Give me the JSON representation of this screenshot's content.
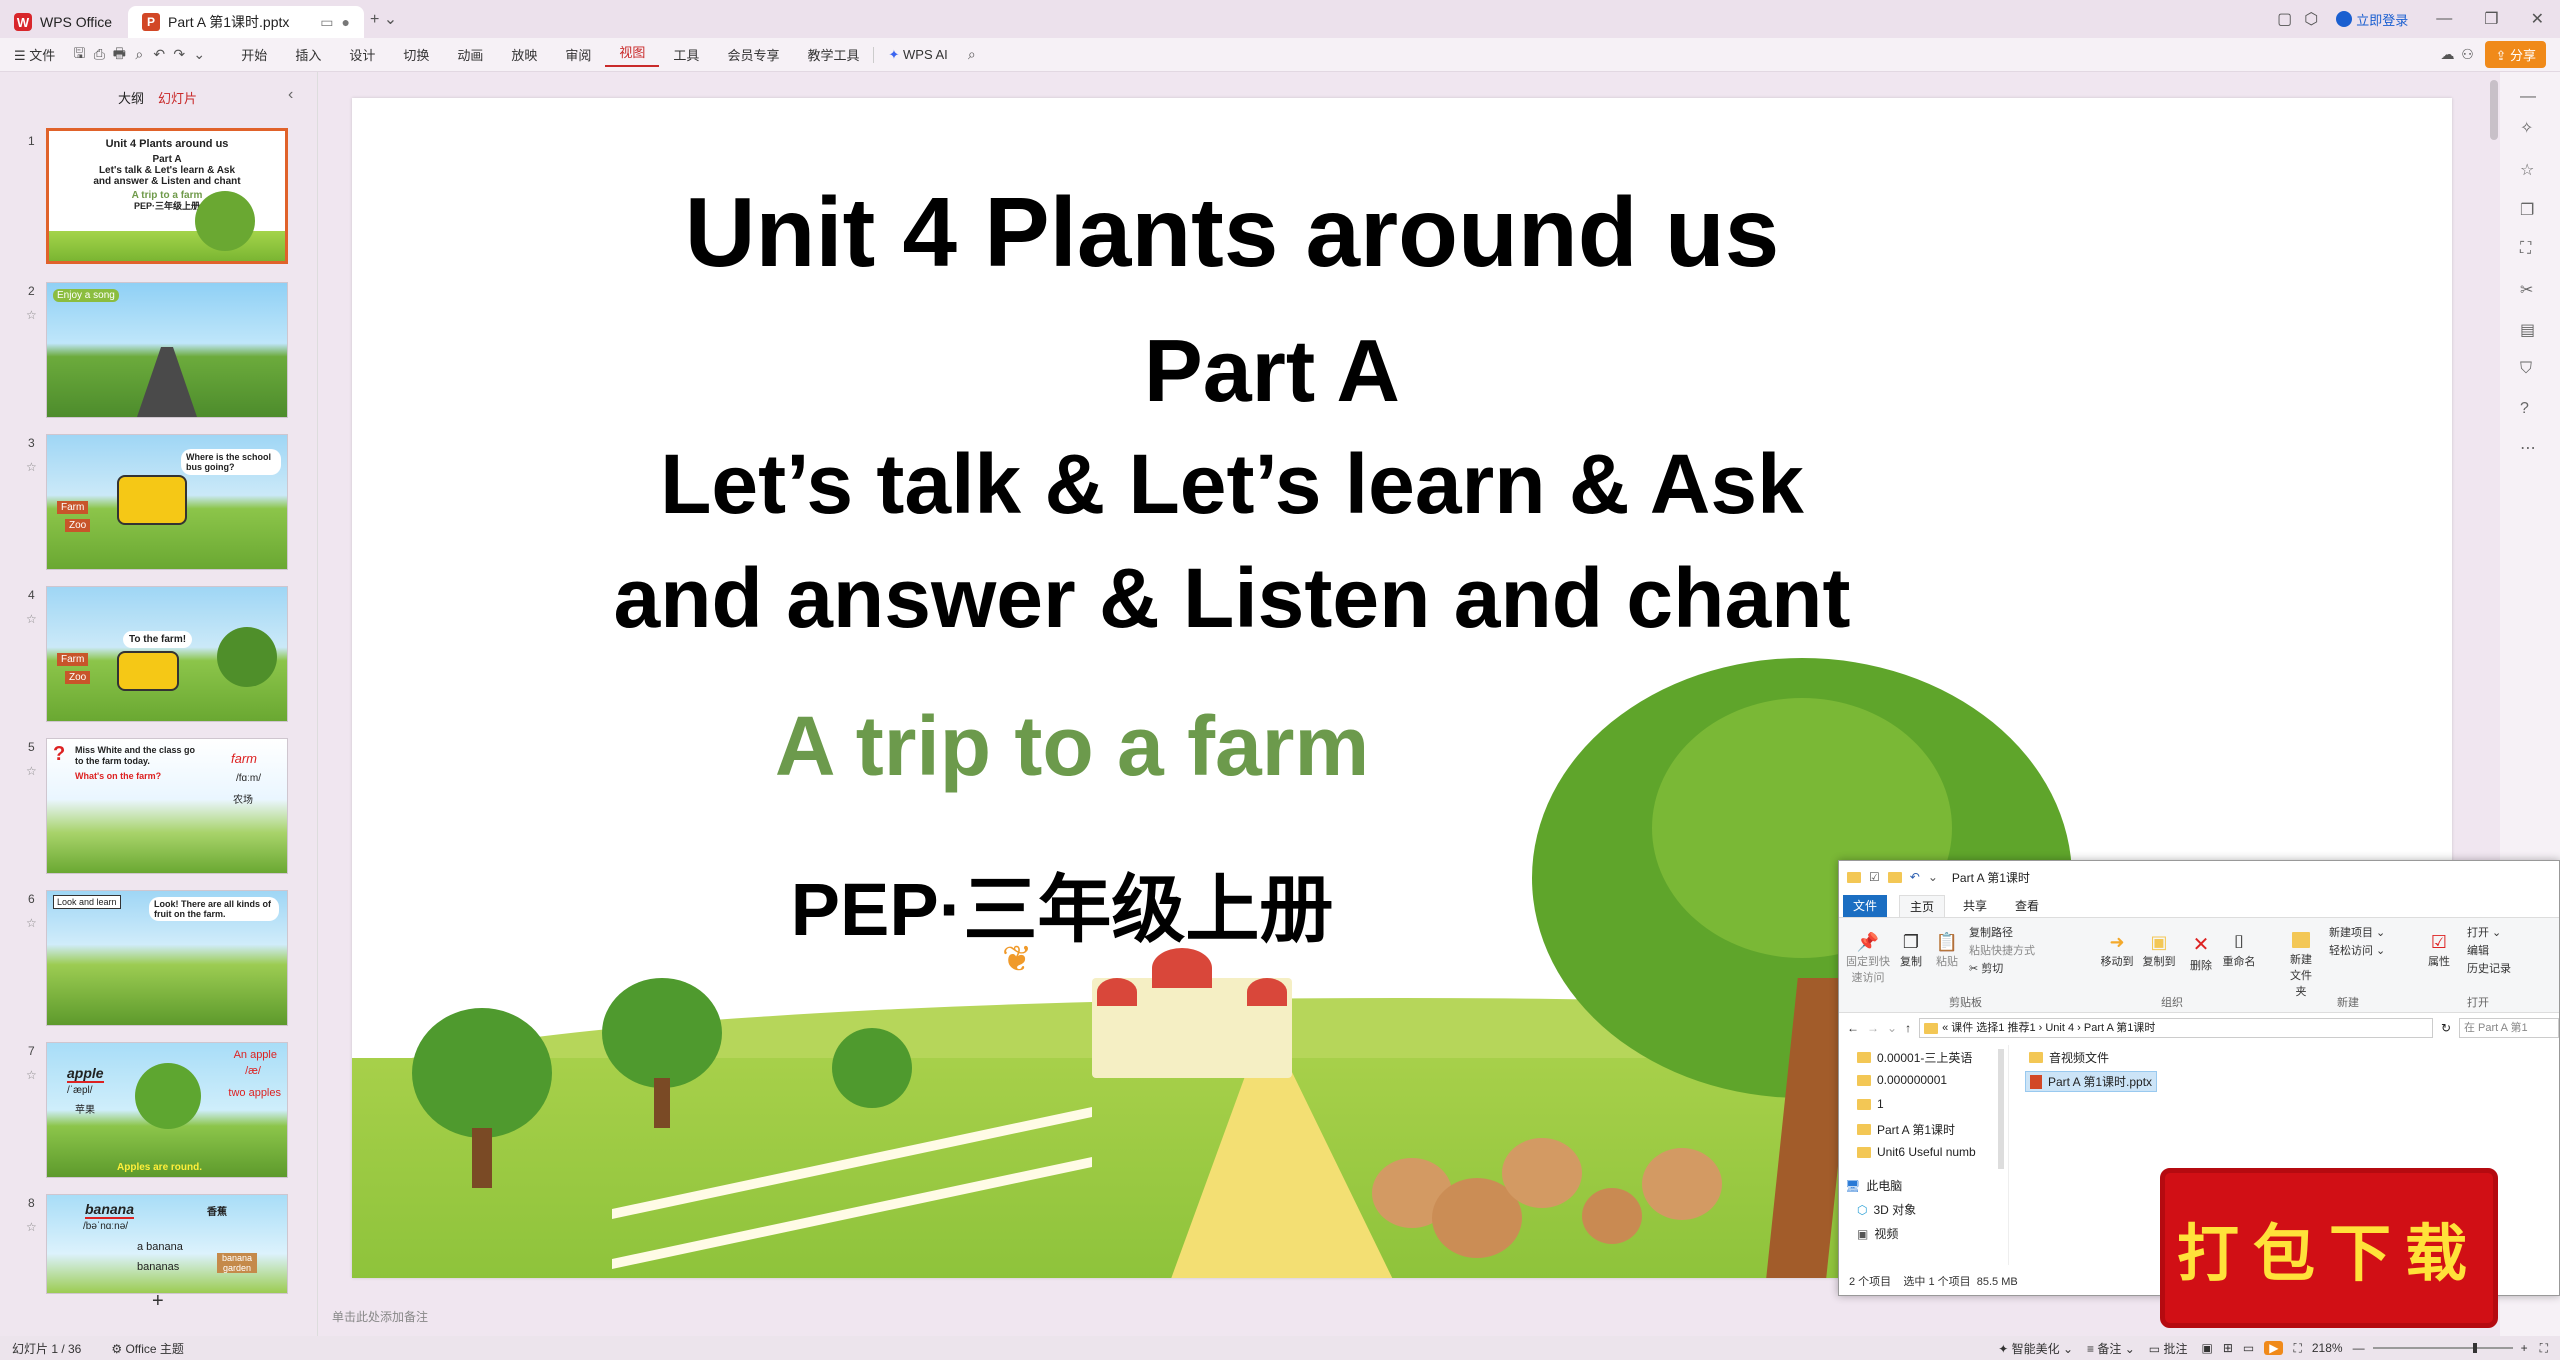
{
  "titlebar": {
    "app_name": "WPS Office",
    "doc_tab": "Part  A 第1课时.pptx",
    "login": "立即登录"
  },
  "menubar": {
    "file": "文件",
    "items": [
      "开始",
      "插入",
      "设计",
      "切换",
      "动画",
      "放映",
      "审阅",
      "视图",
      "工具",
      "会员专享",
      "教学工具"
    ],
    "wps_ai": "WPS AI",
    "share": "分享"
  },
  "leftpanel": {
    "tab_outline": "大纲",
    "tab_slides": "幻灯片",
    "add": "+",
    "slides": [
      {
        "num": "1",
        "lines": [
          "Unit 4 Plants around us",
          "Part A",
          "Let's talk & Let's learn & Ask",
          "and answer & Listen and chant",
          "A trip to a farm",
          "PEP·三年级上册"
        ]
      },
      {
        "num": "2",
        "lines": [
          "Enjoy a song"
        ]
      },
      {
        "num": "3",
        "lines": [
          "Where is the school bus going?",
          "Farm",
          "Zoo"
        ]
      },
      {
        "num": "4",
        "lines": [
          "To the farm!",
          "Farm",
          "Zoo"
        ]
      },
      {
        "num": "5",
        "lines": [
          "Miss White and the class go to the farm today.",
          "What's on the farm?",
          "farm",
          "/fɑːm/",
          "农场"
        ]
      },
      {
        "num": "6",
        "lines": [
          "Look and learn",
          "Look! There are all kinds of fruit on the farm."
        ]
      },
      {
        "num": "7",
        "lines": [
          "apple",
          "/ˈæpl/",
          "苹果",
          "An apple",
          "/æ/",
          "two apples",
          "Apples are round."
        ]
      },
      {
        "num": "8",
        "lines": [
          "banana",
          "/bəˈnɑːnə/",
          "香蕉",
          "a banana",
          "bananas",
          "banana garden"
        ]
      }
    ]
  },
  "slide": {
    "title": "Unit 4 Plants around us",
    "part": "Part A",
    "line1": "Let’s talk & Let’s learn & Ask",
    "line2": "and answer & Listen and chant",
    "subtitle": "A trip to a farm",
    "grade": "PEP·三年级上册"
  },
  "notes_placeholder": "单击此处添加备注",
  "statusbar": {
    "slide_count": "幻灯片 1 / 36",
    "theme": "Office 主题",
    "beautify": "智能美化",
    "notes": "备注",
    "comment": "批注",
    "zoom": "218%"
  },
  "explorer": {
    "title": "Part  A 第1课时",
    "tabs": [
      "文件",
      "主页",
      "共享",
      "查看"
    ],
    "ribbon": {
      "pin": "固定到快速访问",
      "copy": "复制",
      "paste": "粘贴",
      "copy_path": "复制路径",
      "paste_shortcut": "粘贴快捷方式",
      "cut": "剪切",
      "clipboard": "剪贴板",
      "move_to": "移动到",
      "copy_to": "复制到",
      "delete": "删除",
      "rename": "重命名",
      "organize": "组织",
      "new_folder": "新建文件夹",
      "new_item": "新建项目",
      "easy_access": "轻松访问",
      "new": "新建",
      "properties": "属性",
      "open": "打开",
      "edit": "编辑",
      "history": "历史记录",
      "open_group": "打开"
    },
    "breadcrumb": "« 课件 选择1 推荐1 › Unit 4 › Part  A 第1课时",
    "search_placeholder": "在 Part A 第1",
    "tree": [
      "0.00001-三上英语",
      "0.000000001",
      "1",
      "Part  A 第1课时",
      "Unit6 Useful numb",
      "此电脑",
      "3D 对象",
      "视频"
    ],
    "files": [
      "音视频文件",
      "Part  A 第1课时.pptx"
    ],
    "status": "2 个项目    选中 1 个项目  85.5 MB"
  },
  "download_badge": "打包下载"
}
